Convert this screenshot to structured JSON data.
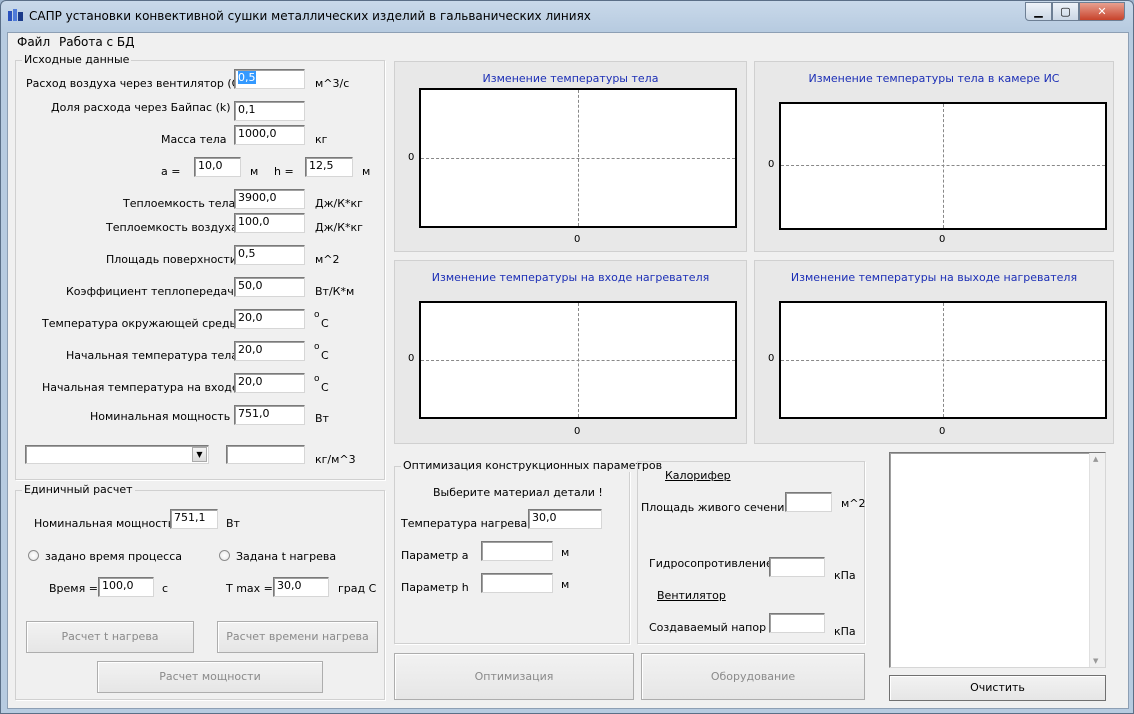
{
  "window": {
    "title": "САПР установки конвективной сушки металлических изделий в гальванических линиях",
    "minimize": "▁",
    "maximize": "▢",
    "close": "✕"
  },
  "menu": {
    "file": "Файл",
    "db": "Работа с БД"
  },
  "inputs": {
    "group_title": "Исходные данные",
    "air_flow_label": "Расход воздуха через вентилятор (G) =",
    "air_flow_value": "0,5",
    "air_flow_unit": "м^3/с",
    "bypass_label": "Доля расхода через Байпас (k) =",
    "bypass_value": "0,1",
    "mass_label": "Масса тела",
    "mass_value": "1000,0",
    "mass_unit": "кг",
    "a_label": "a =",
    "a_value": "10,0",
    "a_unit": "м",
    "h_label": "h =",
    "h_value": "12,5",
    "h_unit": "м",
    "heat_cap_body_label": "Теплоемкость тела",
    "heat_cap_body_value": "3900,0",
    "heat_cap_body_unit": "Дж/К*кг",
    "heat_cap_air_label": "Теплоемкость воздуха",
    "heat_cap_air_value": "100,0",
    "heat_cap_air_unit": "Дж/К*кг",
    "surface_label": "Площадь поверхности",
    "surface_value": "0,5",
    "surface_unit": "м^2",
    "htc_label": "Коэффициент теплопередачи =",
    "htc_value": "50,0",
    "htc_unit": "Вт/К*м",
    "ambient_label": "Температура окружающей среды =",
    "ambient_value": "20,0",
    "init_body_label": "Начальная температура тела =",
    "init_body_value": "20,0",
    "init_inlet_label": "Начальная температура на входе =",
    "init_inlet_value": "20,0",
    "deg_o": "o",
    "deg_c": "C",
    "power_label": "Номинальная мощность =",
    "power_value": "751,0",
    "power_unit": "Вт",
    "density_unit": "кг/м^3"
  },
  "single": {
    "group_title": "Единичный расчет",
    "power_label": "Номинальная мощность",
    "power_value": "751,1",
    "power_unit": "Вт",
    "radio_time": "задано время процесса",
    "radio_t": "Задана t нагрева",
    "time_label": "Время =",
    "time_value": "100,0",
    "time_unit": "с",
    "tmax_label": "T max =",
    "tmax_value": "30,0",
    "tmax_unit": "град С",
    "btn_t": "Расчет t нагрева",
    "btn_time": "Расчет времени нагрева",
    "btn_power": "Расчет мощности"
  },
  "charts": {
    "body": "Изменение температуры тела",
    "chamber": "Изменение температуры тела в камере ИС",
    "inlet": "Изменение температуры на входе нагревателя",
    "outlet": "Изменение температуры на выходе нагревателя",
    "zero": "0"
  },
  "chart_data": [
    {
      "type": "line",
      "title": "Изменение температуры тела",
      "x_tick_labels": [
        "0"
      ],
      "y_tick_labels": [
        "0"
      ],
      "series": [],
      "grid": true
    },
    {
      "type": "line",
      "title": "Изменение температуры тела в камере ИС",
      "x_tick_labels": [
        "0"
      ],
      "y_tick_labels": [
        "0"
      ],
      "series": [],
      "grid": true
    },
    {
      "type": "line",
      "title": "Изменение температуры на входе нагревателя",
      "x_tick_labels": [
        "0"
      ],
      "y_tick_labels": [
        "0"
      ],
      "series": [],
      "grid": true
    },
    {
      "type": "line",
      "title": "Изменение температуры на выходе нагревателя",
      "x_tick_labels": [
        "0"
      ],
      "y_tick_labels": [
        "0"
      ],
      "series": [],
      "grid": true
    }
  ],
  "optim": {
    "group_title": "Оптимизация конструкционных параметров",
    "choose_material": "Выберите материал детали !",
    "temp_label": "Температура нагрева",
    "temp_value": "30,0",
    "param_a": "Параметр a",
    "param_h": "Параметр h",
    "unit_m": "м",
    "btn": "Оптимизация"
  },
  "equip": {
    "calorifer": "Калорифер",
    "section_label": "Площадь живого сечения",
    "section_unit": "м^2",
    "hydro_label": "Гидросопротивление",
    "hydro_unit": "кПа",
    "fan": "Вентилятор",
    "head_label": "Создаваемый напор",
    "head_unit": "кПа",
    "btn": "Оборудование"
  },
  "log": {
    "clear": "Очистить"
  }
}
